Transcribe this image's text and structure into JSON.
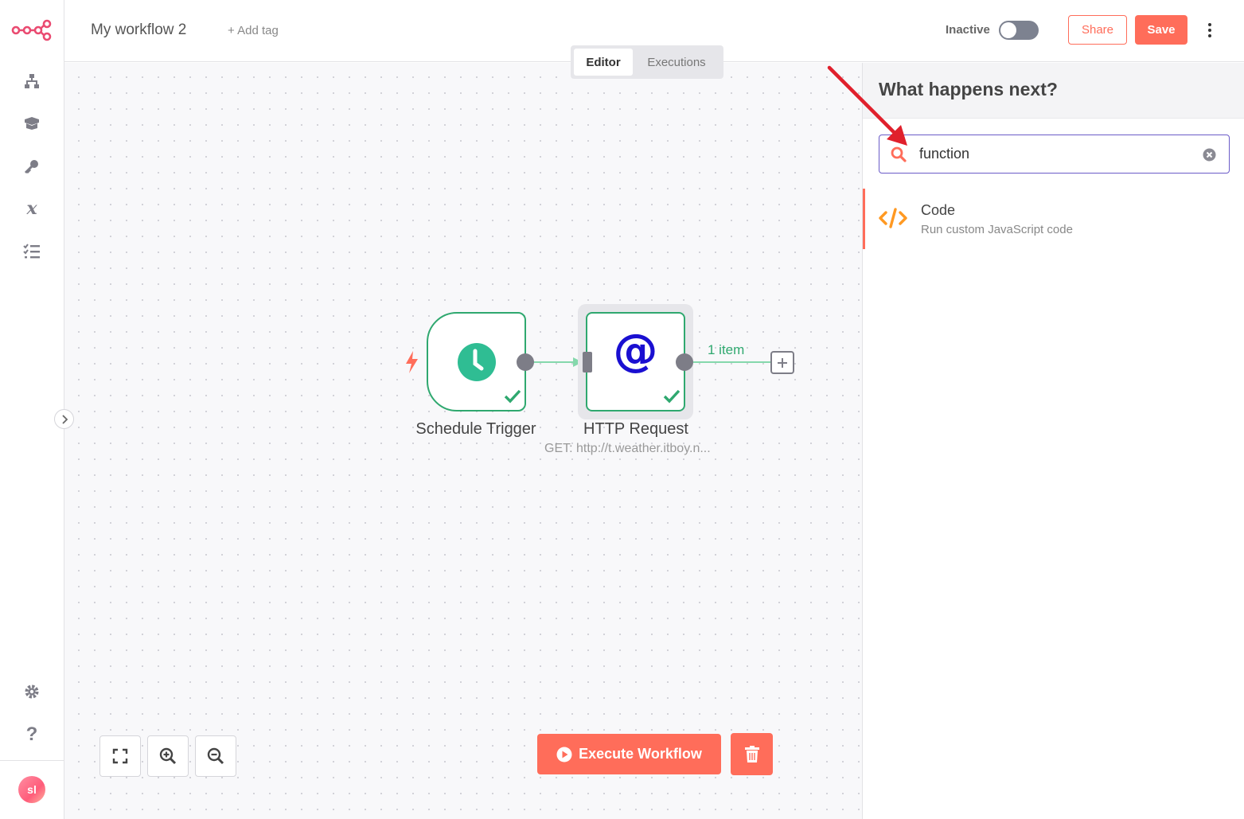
{
  "header": {
    "workflow_name": "My workflow 2",
    "add_tag": "+ Add tag",
    "status_label": "Inactive",
    "share_label": "Share",
    "save_label": "Save"
  },
  "tabs": {
    "editor": "Editor",
    "executions": "Executions"
  },
  "sidebar": {
    "avatar_initials": "sl",
    "icons": [
      "workflows-icon",
      "templates-icon",
      "credentials-icon",
      "variables-icon",
      "executions-icon",
      "settings-icon",
      "help-icon"
    ]
  },
  "nodes": [
    {
      "name": "Schedule Trigger",
      "subtitle": ""
    },
    {
      "name": "HTTP Request",
      "subtitle": "GET: http://t.weather.itboy.n..."
    }
  ],
  "connection": {
    "output_label": "1 item"
  },
  "canvas_controls": {
    "execute_label": "Execute Workflow"
  },
  "panel": {
    "title": "What happens next?",
    "search_value": "function",
    "results": [
      {
        "title": "Code",
        "description": "Run custom JavaScript code"
      }
    ]
  },
  "colors": {
    "accent": "#ff6d5a",
    "success": "#2fa86f",
    "search_border": "#6b5bc8",
    "http_icon": "#1a0fd1"
  }
}
